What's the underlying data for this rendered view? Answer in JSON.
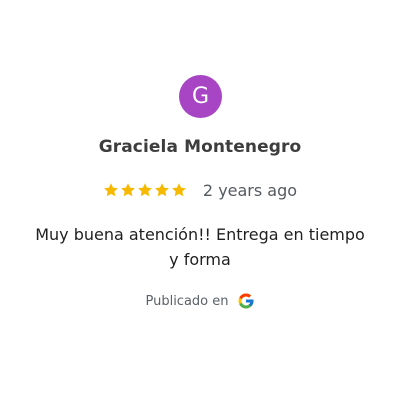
{
  "review": {
    "avatar_initial": "G",
    "avatar_color": "#a745c4",
    "author": "Graciela Montenegro",
    "rating": 5,
    "rating_max": 5,
    "star_color": "#f6b900",
    "date": "2 years ago",
    "text": "Muy buena atención!! Entrega en tiempo y forma",
    "published_label": "Publicado en",
    "source_icon": "google-icon"
  }
}
